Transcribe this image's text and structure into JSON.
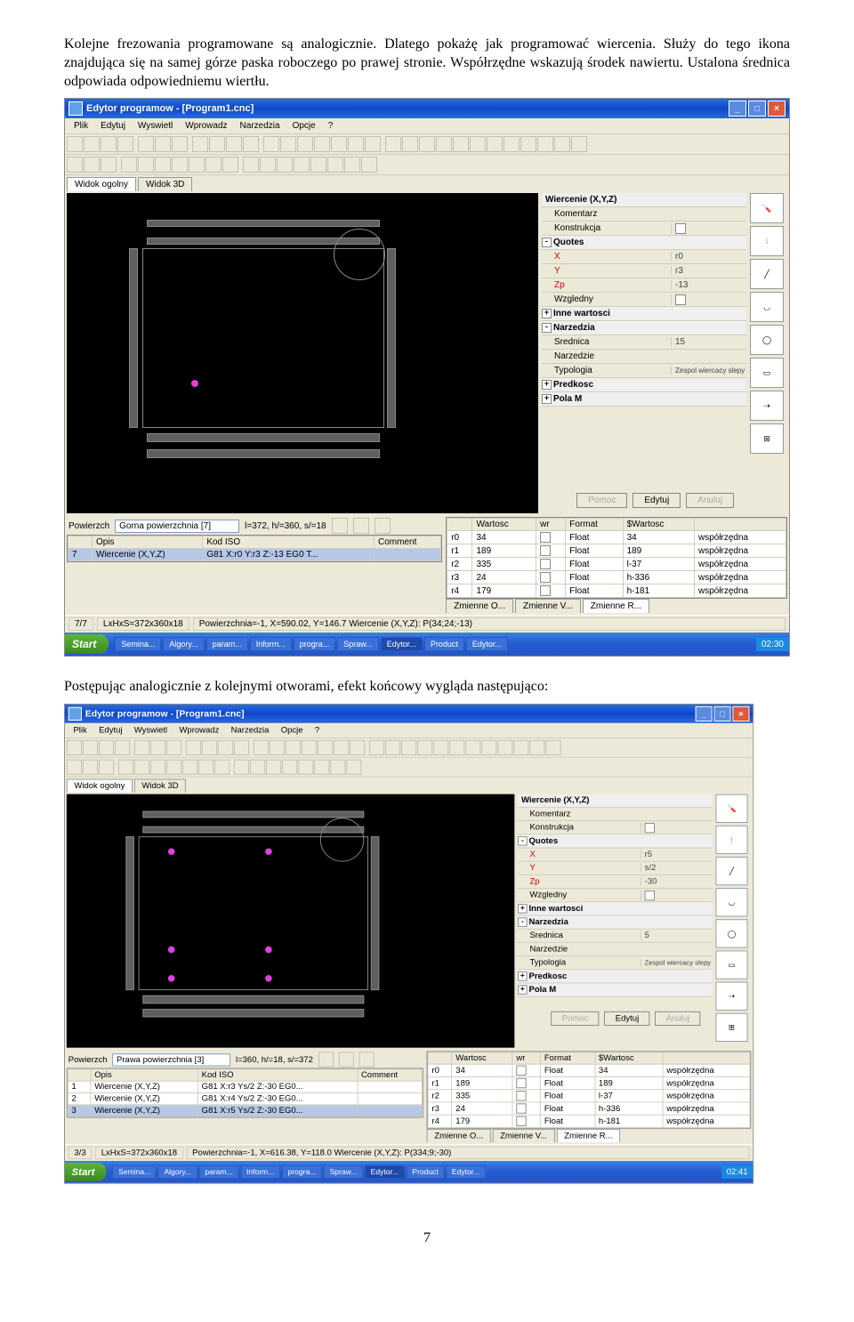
{
  "para1": "Kolejne frezowania programowane są analogicznie. Dlatego pokażę jak programować wiercenia. Służy do tego ikona znajdująca się na samej górze paska roboczego po prawej stronie. Współrzędne wskazują środek nawiertu. Ustalona średnica odpowiada odpowiedniemu wiertłu.",
  "para2": "Postępując analogicznie z kolejnymi otworami, efekt końcowy wygląda następująco:",
  "pagenum": "7",
  "app1": {
    "title": "Edytor programow - [Program1.cnc]",
    "menu": [
      "Plik",
      "Edytuj",
      "Wyswietl",
      "Wprowadz",
      "Narzedzia",
      "Opcje",
      "?"
    ],
    "tabs": [
      "Widok ogolny",
      "Widok 3D"
    ],
    "props_title": "Wiercenie (X,Y,Z)",
    "props": [
      {
        "l": "Komentarz",
        "v": ""
      },
      {
        "l": "Konstrukcja",
        "v": "",
        "cb": true
      }
    ],
    "quotes_h": "Quotes",
    "quotes": [
      {
        "l": "X",
        "v": "r0"
      },
      {
        "l": "Y",
        "v": "r3"
      },
      {
        "l": "Zp",
        "v": "-13"
      },
      {
        "l": "Wzgledny",
        "v": "",
        "cb": true
      }
    ],
    "inne_h": "Inne wartosci",
    "narz_h": "Narzedzia",
    "narz": [
      {
        "l": "Srednica",
        "v": "15"
      },
      {
        "l": "Narzedzie",
        "v": ""
      },
      {
        "l": "Typologia",
        "v": "Zespol wiercacy slepy"
      }
    ],
    "pred_h": "Predkosc",
    "pola_h": "Pola M",
    "btn_pomoc": "Pomoc",
    "btn_edytuj": "Edytuj",
    "btn_anuluj": "Anuluj",
    "surf_label": "Powierzch",
    "surf_sel": "Gorna powierzchnia [7]",
    "surf_info": "l=372, h/=360, s/=18",
    "list_h": [
      "",
      "Opis",
      "Kod ISO",
      "Comment"
    ],
    "list_r": [
      "7",
      "Wiercenie (X,Y,Z)",
      "G81 X:r0 Y:r3 Z:-13 EG0 T...",
      ""
    ],
    "vars_h": [
      "",
      "Wartosc",
      "wr",
      "Format",
      "$Wartosc",
      ""
    ],
    "vars": [
      [
        "r0",
        "34",
        "",
        "Float",
        "34",
        "współrzędna"
      ],
      [
        "r1",
        "189",
        "",
        "Float",
        "189",
        "współrzędna"
      ],
      [
        "r2",
        "335",
        "",
        "Float",
        "l-37",
        "współrzędna"
      ],
      [
        "r3",
        "24",
        "",
        "Float",
        "h-336",
        "współrzędna"
      ],
      [
        "r4",
        "179",
        "",
        "Float",
        "h-181",
        "współrzędna"
      ]
    ],
    "vartabs": [
      "Zmienne O...",
      "Zmienne V...",
      "Zmienne R..."
    ],
    "status_l": "7/7",
    "status_m": "LxHxS=372x360x18",
    "status_r": "Powierzchnia=-1, X=590.02, Y=146.7  Wiercenie (X,Y,Z): P(34;24;-13)",
    "tasks": [
      "Semina...",
      "Algory...",
      "param...",
      "Inform...",
      "progra...",
      "Spraw...",
      "Edytor...",
      "Product",
      "Edytor..."
    ],
    "time": "02:30"
  },
  "app2": {
    "title": "Edytor programow - [Program1.cnc]",
    "menu": [
      "Plik",
      "Edytuj",
      "Wyswietl",
      "Wprowadz",
      "Narzedzia",
      "Opcje",
      "?"
    ],
    "tabs": [
      "Widok ogolny",
      "Widok 3D"
    ],
    "props_title": "Wiercenie (X,Y,Z)",
    "props": [
      {
        "l": "Komentarz",
        "v": ""
      },
      {
        "l": "Konstrukcja",
        "v": "",
        "cb": true
      }
    ],
    "quotes_h": "Quotes",
    "quotes": [
      {
        "l": "X",
        "v": "r5"
      },
      {
        "l": "Y",
        "v": "s/2"
      },
      {
        "l": "Zp",
        "v": "-30"
      },
      {
        "l": "Wzgledny",
        "v": "",
        "cb": true
      }
    ],
    "inne_h": "Inne wartosci",
    "narz_h": "Narzedzia",
    "narz": [
      {
        "l": "Srednica",
        "v": "5"
      },
      {
        "l": "Narzedzie",
        "v": ""
      },
      {
        "l": "Typologia",
        "v": "Zespol wiercacy slepy"
      }
    ],
    "pred_h": "Predkosc",
    "pola_h": "Pola M",
    "btn_pomoc": "Pomoc",
    "btn_edytuj": "Edytuj",
    "btn_anuluj": "Anuluj",
    "surf_label": "Powierzch",
    "surf_sel": "Prawa powierzchnia [3]",
    "surf_info": "l=360, h/=18, s/=372",
    "list_h": [
      "",
      "Opis",
      "Kod ISO",
      "Comment"
    ],
    "list_rows": [
      [
        "1",
        "Wiercenie (X,Y,Z)",
        "G81 X:r3 Ys/2 Z:-30 EG0...",
        ""
      ],
      [
        "2",
        "Wiercenie (X,Y,Z)",
        "G81 X:r4 Ys/2 Z:-30 EG0...",
        ""
      ],
      [
        "3",
        "Wiercenie (X,Y,Z)",
        "G81 X:r5 Ys/2 Z:-30 EG0...",
        ""
      ]
    ],
    "vars_h": [
      "",
      "Wartosc",
      "wr",
      "Format",
      "$Wartosc",
      ""
    ],
    "vars": [
      [
        "r0",
        "34",
        "",
        "Float",
        "34",
        "współrzędna"
      ],
      [
        "r1",
        "189",
        "",
        "Float",
        "189",
        "współrzędna"
      ],
      [
        "r2",
        "335",
        "",
        "Float",
        "l-37",
        "współrzędna"
      ],
      [
        "r3",
        "24",
        "",
        "Float",
        "h-336",
        "współrzędna"
      ],
      [
        "r4",
        "179",
        "",
        "Float",
        "h-181",
        "współrzędna"
      ]
    ],
    "vartabs": [
      "Zmienne O...",
      "Zmienne V...",
      "Zmienne R..."
    ],
    "status_l": "3/3",
    "status_m": "LxHxS=372x360x18",
    "status_r": "Powierzchnia=-1, X=616.38, Y=118.0  Wiercenie (X,Y,Z): P(334;9;-30)",
    "tasks": [
      "Semina...",
      "Algory...",
      "param...",
      "Inform...",
      "progra...",
      "Spraw...",
      "Edytor...",
      "Product",
      "Edytor..."
    ],
    "time": "02:41"
  }
}
